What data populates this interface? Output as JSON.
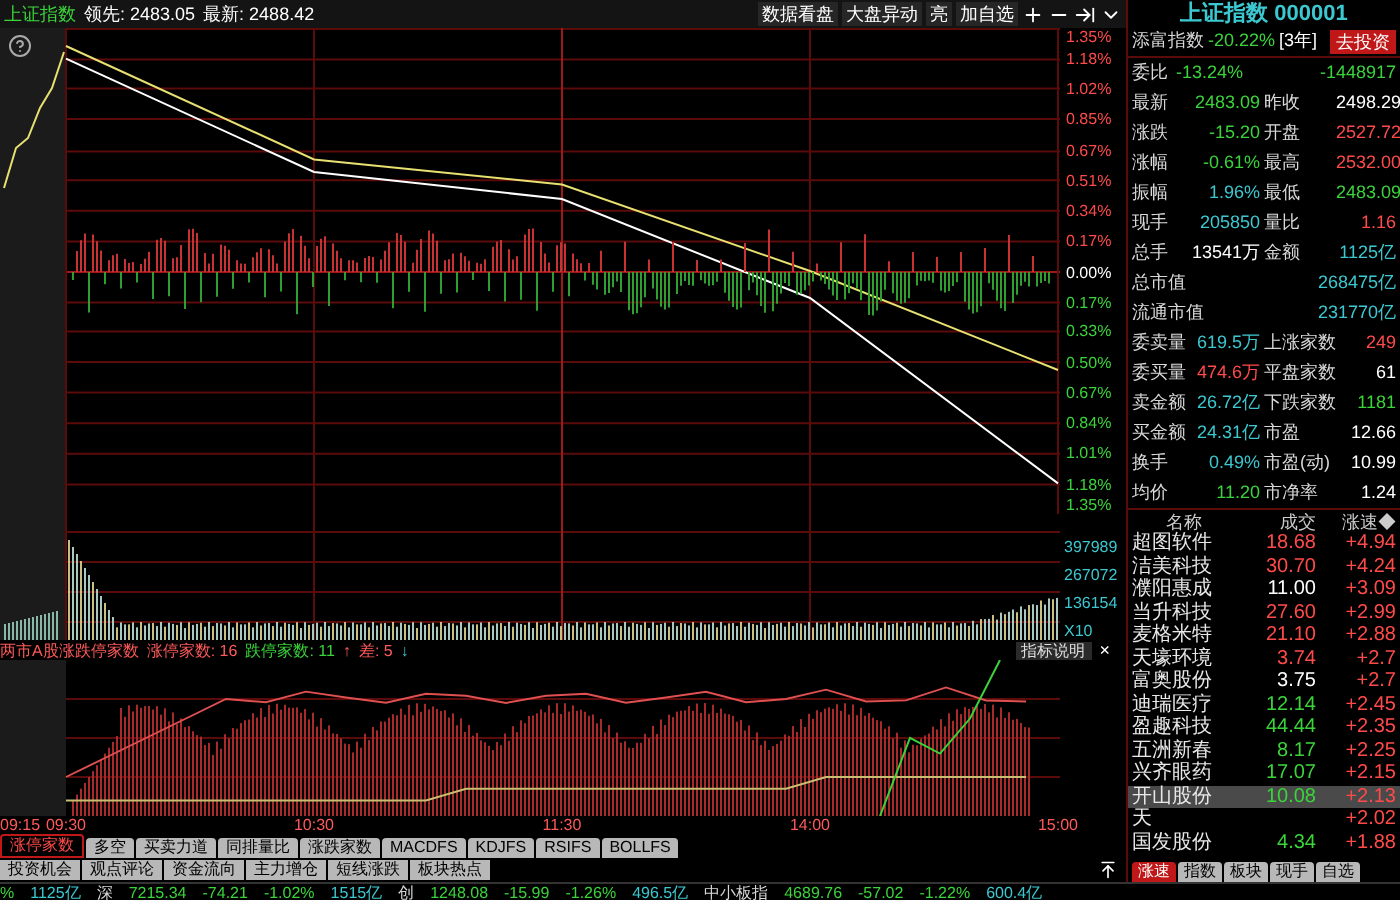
{
  "header": {
    "title": "上证指数",
    "lead": "领先: 2483.05",
    "latest": "最新: 2488.42",
    "buttons": [
      "数据看盘",
      "大盘异动",
      "亮",
      "加自选"
    ]
  },
  "price_chart": {
    "chart_data": {
      "type": "line",
      "series": [
        {
          "color": "#ffffff",
          "values": [
            1.18,
            0.55,
            0.4,
            -0.15,
            -1.18
          ]
        },
        {
          "color": "#e8e070",
          "values": [
            1.25,
            0.62,
            0.48,
            0.0,
            -0.55
          ]
        }
      ],
      "ylim": [
        -1.35,
        1.35
      ],
      "grid": true,
      "yticks": [
        {
          "value": 1.35,
          "label": "1.35%"
        },
        {
          "value": 1.18,
          "label": "1.18%"
        },
        {
          "value": 1.02,
          "label": "1.02%"
        },
        {
          "value": 0.85,
          "label": "0.85%"
        },
        {
          "value": 0.67,
          "label": "0.67%"
        },
        {
          "value": 0.51,
          "label": "0.51%"
        },
        {
          "value": 0.34,
          "label": "0.34%"
        },
        {
          "value": 0.17,
          "label": "0.17%"
        },
        {
          "value": 0,
          "label": "0.00%"
        },
        {
          "value": -0.17,
          "label": "0.17%"
        },
        {
          "value": -0.33,
          "label": "0.33%"
        },
        {
          "value": -0.5,
          "label": "0.50%"
        },
        {
          "value": -0.67,
          "label": "0.67%"
        },
        {
          "value": -0.84,
          "label": "0.84%"
        },
        {
          "value": -1.01,
          "label": "1.01%"
        },
        {
          "value": -1.18,
          "label": "1.18%"
        },
        {
          "value": -1.35,
          "label": "1.35%"
        }
      ]
    }
  },
  "volume_axis": [
    "397989",
    "267072",
    "136154",
    "X10"
  ],
  "indicator": {
    "title": "两市A股涨跌停家数",
    "up_label": "涨停家数: 16",
    "down_label": "跌停家数: 11",
    "up_arrow": "↑",
    "diff_label": "差: 5",
    "down_arrow": "↓",
    "help_button": "指标说明",
    "close": "×"
  },
  "premarket_time": "09:15",
  "time_axis": [
    "09:30",
    "10:30",
    "11:30",
    "14:00",
    "15:00"
  ],
  "indicator_tabs": [
    {
      "label": "涨停家数",
      "selected": true
    },
    {
      "label": "多空",
      "selected": false
    },
    {
      "label": "买卖力道",
      "selected": false
    },
    {
      "label": "同排量比",
      "selected": false
    },
    {
      "label": "涨跌家数",
      "selected": false
    },
    {
      "label": "MACDFS",
      "selected": false
    },
    {
      "label": "KDJFS",
      "selected": false
    },
    {
      "label": "RSIFS",
      "selected": false
    },
    {
      "label": "BOLLFS",
      "selected": false
    }
  ],
  "info_buttons": [
    "投资机会",
    "观点评论",
    "资金流向",
    "主力增仓",
    "短线涨跌",
    "板块热点"
  ],
  "quote": {
    "title": "上证指数 000001",
    "rows": [
      {
        "kind": "promo",
        "cells": [
          {
            "text": "添富指数"
          },
          {
            "text": "-20.22%",
            "color": "#3ad43a"
          },
          {
            "text": "[3年]",
            "color": "#ffffff"
          }
        ],
        "button": "去投资"
      },
      {
        "kind": "pair",
        "cells": [
          {
            "text": "委比"
          },
          {
            "text": "-13.24%",
            "color": "#3ad43a"
          },
          {
            "text": "-1448917",
            "color": "#3ad43a"
          }
        ]
      },
      {
        "kind": "quad",
        "cells": [
          {
            "text": "最新"
          },
          {
            "text": "2483.09",
            "color": "#3ad43a"
          },
          {
            "text": "昨收"
          },
          {
            "text": "2498.29",
            "color": "#ffffff"
          }
        ]
      },
      {
        "kind": "quad",
        "cells": [
          {
            "text": "涨跌"
          },
          {
            "text": "-15.20",
            "color": "#3ad43a"
          },
          {
            "text": "开盘"
          },
          {
            "text": "2527.72",
            "color": "#ff4a4a"
          }
        ]
      },
      {
        "kind": "quad",
        "cells": [
          {
            "text": "涨幅"
          },
          {
            "text": "-0.61%",
            "color": "#3ad43a"
          },
          {
            "text": "最高"
          },
          {
            "text": "2532.00",
            "color": "#ff4a4a"
          }
        ]
      },
      {
        "kind": "quad",
        "cells": [
          {
            "text": "振幅"
          },
          {
            "text": "1.96%",
            "color": "#3cc8d0"
          },
          {
            "text": "最低"
          },
          {
            "text": "2483.09",
            "color": "#3ad43a"
          }
        ]
      },
      {
        "kind": "quad",
        "cells": [
          {
            "text": "现手"
          },
          {
            "text": "205850",
            "color": "#3cc8d0"
          },
          {
            "text": "量比"
          },
          {
            "text": "1.16",
            "color": "#ff4a4a"
          }
        ]
      },
      {
        "kind": "quad",
        "cells": [
          {
            "text": "总手"
          },
          {
            "text": "13541万",
            "color": "#ffffff"
          },
          {
            "text": "金额"
          },
          {
            "text": "1125亿",
            "color": "#3cc8d0"
          }
        ]
      },
      {
        "kind": "pair",
        "cells": [
          {
            "text": "总市值"
          },
          {
            "text": "268475亿",
            "color": "#3cc8d0"
          }
        ]
      },
      {
        "kind": "pair",
        "cells": [
          {
            "text": "流通市值"
          },
          {
            "text": "231770亿",
            "color": "#3cc8d0"
          }
        ]
      },
      {
        "kind": "quad",
        "cells": [
          {
            "text": "委卖量"
          },
          {
            "text": "619.5万",
            "color": "#3cc8d0"
          },
          {
            "text": "上涨家数"
          },
          {
            "text": "249",
            "color": "#ff4a4a"
          }
        ]
      },
      {
        "kind": "quad",
        "cells": [
          {
            "text": "委买量"
          },
          {
            "text": "474.6万",
            "color": "#ff4a4a"
          },
          {
            "text": "平盘家数"
          },
          {
            "text": "61",
            "color": "#ffffff"
          }
        ]
      },
      {
        "kind": "quad",
        "cells": [
          {
            "text": "卖金额"
          },
          {
            "text": "26.72亿",
            "color": "#3cc8d0"
          },
          {
            "text": "下跌家数"
          },
          {
            "text": "1181",
            "color": "#3ad43a"
          }
        ]
      },
      {
        "kind": "quad",
        "cells": [
          {
            "text": "买金额"
          },
          {
            "text": "24.31亿",
            "color": "#3cc8d0"
          },
          {
            "text": "市盈"
          },
          {
            "text": "12.66",
            "color": "#ffffff"
          }
        ]
      },
      {
        "kind": "quad",
        "cells": [
          {
            "text": "换手"
          },
          {
            "text": "0.49%",
            "color": "#3cc8d0"
          },
          {
            "text": "市盈(动)"
          },
          {
            "text": "10.99",
            "color": "#ffffff"
          }
        ]
      },
      {
        "kind": "quad",
        "cells": [
          {
            "text": "均价"
          },
          {
            "text": "11.20",
            "color": "#3ad43a"
          },
          {
            "text": "市净率"
          },
          {
            "text": "1.24",
            "color": "#ffffff"
          }
        ]
      }
    ]
  },
  "stock_list": {
    "columns": [
      "名称",
      "成交",
      "涨速◆"
    ],
    "rows": [
      {
        "name": "超图软件",
        "price": "18.68",
        "kind": "up",
        "change": "+4.94",
        "selected": false
      },
      {
        "name": "洁美科技",
        "price": "30.70",
        "kind": "up",
        "change": "+4.24",
        "selected": false
      },
      {
        "name": "濮阳惠成",
        "price": "11.00",
        "kind": "flat",
        "change": "+3.09",
        "selected": false
      },
      {
        "name": "当升科技",
        "price": "27.60",
        "kind": "up",
        "change": "+2.99",
        "selected": false
      },
      {
        "name": "麦格米特",
        "price": "21.10",
        "kind": "up",
        "change": "+2.88",
        "selected": false
      },
      {
        "name": "天壕环境",
        "price": "3.74",
        "kind": "up",
        "change": "+2.7",
        "selected": false
      },
      {
        "name": "富奥股份",
        "price": "3.75",
        "kind": "flat",
        "change": "+2.7",
        "selected": false
      },
      {
        "name": "迪瑞医疗",
        "price": "12.14",
        "kind": "down",
        "change": "+2.45",
        "selected": false
      },
      {
        "name": "盈趣科技",
        "price": "44.44",
        "kind": "down",
        "change": "+2.35",
        "selected": false
      },
      {
        "name": "五洲新春",
        "price": "8.17",
        "kind": "down",
        "change": "+2.25",
        "selected": false
      },
      {
        "name": "兴齐眼药",
        "price": "17.07",
        "kind": "down",
        "change": "+2.15",
        "selected": false
      },
      {
        "name": "开山股份",
        "price": "10.08",
        "kind": "down",
        "change": "+2.13",
        "selected": true
      },
      {
        "name": "天",
        "change": "+2.02",
        "selected": false
      },
      {
        "name": "国发股份",
        "price": "4.34",
        "kind": "down",
        "change": "+1.88",
        "selected": false
      }
    ]
  },
  "list_tabs": [
    {
      "label": "涨速",
      "selected": true
    },
    {
      "label": "指数",
      "selected": false
    },
    {
      "label": "板块",
      "selected": false
    },
    {
      "label": "现手",
      "selected": false
    },
    {
      "label": "自选",
      "selected": false
    }
  ],
  "status_bar": [
    {
      "text": "%",
      "color": "#3ad43a"
    },
    {
      "text": "1125亿",
      "color": "#3cc8d0"
    },
    {
      "text": "深"
    },
    {
      "text": "7215.34",
      "color": "#3ad43a"
    },
    {
      "text": "-74.21",
      "color": "#3ad43a"
    },
    {
      "text": "-1.02%",
      "color": "#3ad43a"
    },
    {
      "text": "1515亿",
      "color": "#3cc8d0"
    },
    {
      "text": "创"
    },
    {
      "text": "1248.08",
      "color": "#3ad43a"
    },
    {
      "text": "-15.99",
      "color": "#3ad43a"
    },
    {
      "text": "-1.26%",
      "color": "#3ad43a"
    },
    {
      "text": "496.5亿",
      "color": "#3cc8d0"
    },
    {
      "text": "中小板指"
    },
    {
      "text": "4689.76",
      "color": "#3ad43a"
    },
    {
      "text": "-57.02",
      "color": "#3ad43a"
    },
    {
      "text": "-1.22%",
      "color": "#3ad43a"
    },
    {
      "text": "600.4亿",
      "color": "#3cc8d0"
    }
  ]
}
